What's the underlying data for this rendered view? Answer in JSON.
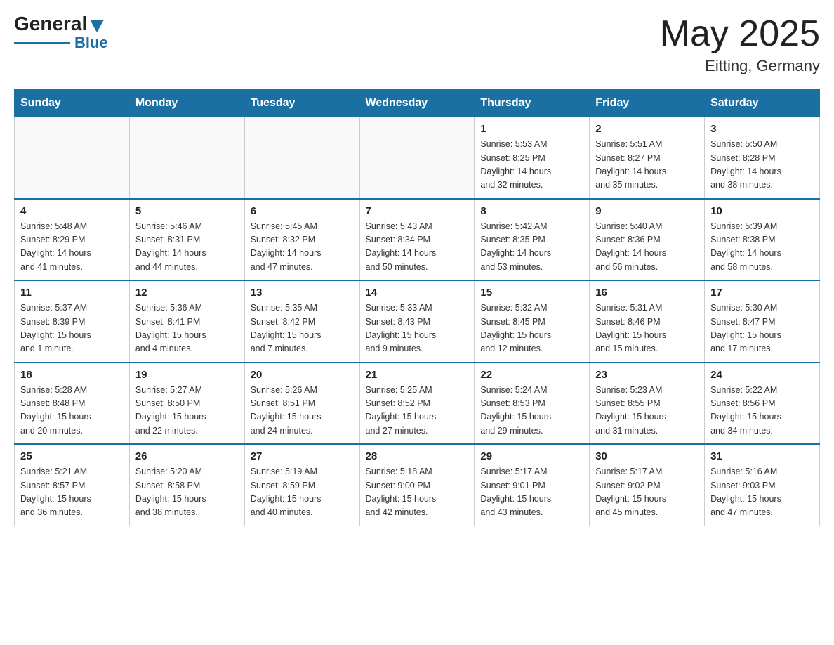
{
  "header": {
    "logo_general": "General",
    "logo_blue": "Blue",
    "month_year": "May 2025",
    "location": "Eitting, Germany"
  },
  "days_of_week": [
    "Sunday",
    "Monday",
    "Tuesday",
    "Wednesday",
    "Thursday",
    "Friday",
    "Saturday"
  ],
  "weeks": [
    [
      {
        "day": "",
        "info": ""
      },
      {
        "day": "",
        "info": ""
      },
      {
        "day": "",
        "info": ""
      },
      {
        "day": "",
        "info": ""
      },
      {
        "day": "1",
        "info": "Sunrise: 5:53 AM\nSunset: 8:25 PM\nDaylight: 14 hours\nand 32 minutes."
      },
      {
        "day": "2",
        "info": "Sunrise: 5:51 AM\nSunset: 8:27 PM\nDaylight: 14 hours\nand 35 minutes."
      },
      {
        "day": "3",
        "info": "Sunrise: 5:50 AM\nSunset: 8:28 PM\nDaylight: 14 hours\nand 38 minutes."
      }
    ],
    [
      {
        "day": "4",
        "info": "Sunrise: 5:48 AM\nSunset: 8:29 PM\nDaylight: 14 hours\nand 41 minutes."
      },
      {
        "day": "5",
        "info": "Sunrise: 5:46 AM\nSunset: 8:31 PM\nDaylight: 14 hours\nand 44 minutes."
      },
      {
        "day": "6",
        "info": "Sunrise: 5:45 AM\nSunset: 8:32 PM\nDaylight: 14 hours\nand 47 minutes."
      },
      {
        "day": "7",
        "info": "Sunrise: 5:43 AM\nSunset: 8:34 PM\nDaylight: 14 hours\nand 50 minutes."
      },
      {
        "day": "8",
        "info": "Sunrise: 5:42 AM\nSunset: 8:35 PM\nDaylight: 14 hours\nand 53 minutes."
      },
      {
        "day": "9",
        "info": "Sunrise: 5:40 AM\nSunset: 8:36 PM\nDaylight: 14 hours\nand 56 minutes."
      },
      {
        "day": "10",
        "info": "Sunrise: 5:39 AM\nSunset: 8:38 PM\nDaylight: 14 hours\nand 58 minutes."
      }
    ],
    [
      {
        "day": "11",
        "info": "Sunrise: 5:37 AM\nSunset: 8:39 PM\nDaylight: 15 hours\nand 1 minute."
      },
      {
        "day": "12",
        "info": "Sunrise: 5:36 AM\nSunset: 8:41 PM\nDaylight: 15 hours\nand 4 minutes."
      },
      {
        "day": "13",
        "info": "Sunrise: 5:35 AM\nSunset: 8:42 PM\nDaylight: 15 hours\nand 7 minutes."
      },
      {
        "day": "14",
        "info": "Sunrise: 5:33 AM\nSunset: 8:43 PM\nDaylight: 15 hours\nand 9 minutes."
      },
      {
        "day": "15",
        "info": "Sunrise: 5:32 AM\nSunset: 8:45 PM\nDaylight: 15 hours\nand 12 minutes."
      },
      {
        "day": "16",
        "info": "Sunrise: 5:31 AM\nSunset: 8:46 PM\nDaylight: 15 hours\nand 15 minutes."
      },
      {
        "day": "17",
        "info": "Sunrise: 5:30 AM\nSunset: 8:47 PM\nDaylight: 15 hours\nand 17 minutes."
      }
    ],
    [
      {
        "day": "18",
        "info": "Sunrise: 5:28 AM\nSunset: 8:48 PM\nDaylight: 15 hours\nand 20 minutes."
      },
      {
        "day": "19",
        "info": "Sunrise: 5:27 AM\nSunset: 8:50 PM\nDaylight: 15 hours\nand 22 minutes."
      },
      {
        "day": "20",
        "info": "Sunrise: 5:26 AM\nSunset: 8:51 PM\nDaylight: 15 hours\nand 24 minutes."
      },
      {
        "day": "21",
        "info": "Sunrise: 5:25 AM\nSunset: 8:52 PM\nDaylight: 15 hours\nand 27 minutes."
      },
      {
        "day": "22",
        "info": "Sunrise: 5:24 AM\nSunset: 8:53 PM\nDaylight: 15 hours\nand 29 minutes."
      },
      {
        "day": "23",
        "info": "Sunrise: 5:23 AM\nSunset: 8:55 PM\nDaylight: 15 hours\nand 31 minutes."
      },
      {
        "day": "24",
        "info": "Sunrise: 5:22 AM\nSunset: 8:56 PM\nDaylight: 15 hours\nand 34 minutes."
      }
    ],
    [
      {
        "day": "25",
        "info": "Sunrise: 5:21 AM\nSunset: 8:57 PM\nDaylight: 15 hours\nand 36 minutes."
      },
      {
        "day": "26",
        "info": "Sunrise: 5:20 AM\nSunset: 8:58 PM\nDaylight: 15 hours\nand 38 minutes."
      },
      {
        "day": "27",
        "info": "Sunrise: 5:19 AM\nSunset: 8:59 PM\nDaylight: 15 hours\nand 40 minutes."
      },
      {
        "day": "28",
        "info": "Sunrise: 5:18 AM\nSunset: 9:00 PM\nDaylight: 15 hours\nand 42 minutes."
      },
      {
        "day": "29",
        "info": "Sunrise: 5:17 AM\nSunset: 9:01 PM\nDaylight: 15 hours\nand 43 minutes."
      },
      {
        "day": "30",
        "info": "Sunrise: 5:17 AM\nSunset: 9:02 PM\nDaylight: 15 hours\nand 45 minutes."
      },
      {
        "day": "31",
        "info": "Sunrise: 5:16 AM\nSunset: 9:03 PM\nDaylight: 15 hours\nand 47 minutes."
      }
    ]
  ]
}
